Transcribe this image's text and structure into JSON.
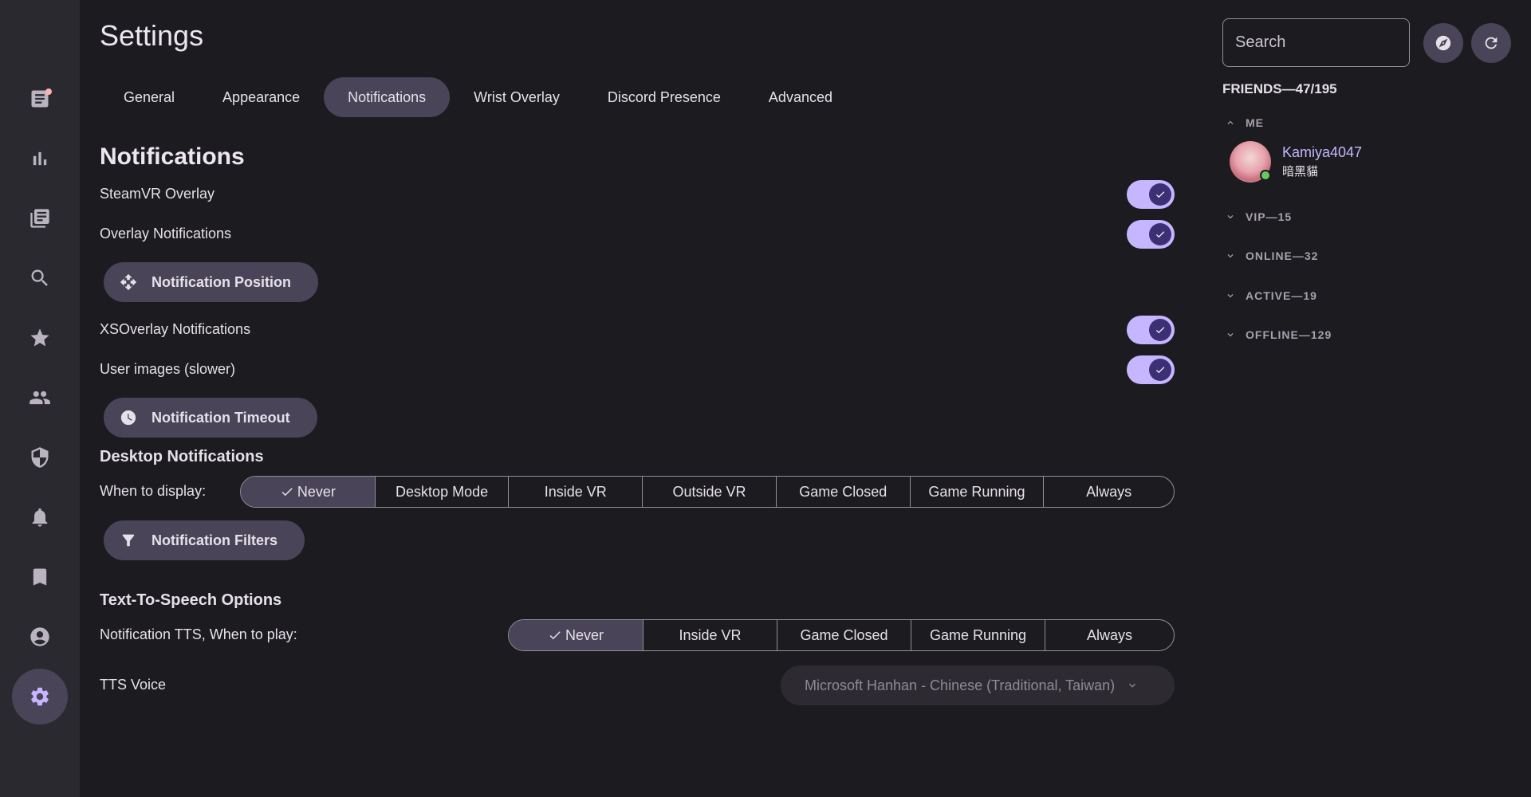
{
  "page": {
    "title": "Settings"
  },
  "tabs": [
    {
      "label": "General"
    },
    {
      "label": "Appearance"
    },
    {
      "label": "Notifications"
    },
    {
      "label": "Wrist Overlay"
    },
    {
      "label": "Discord Presence"
    },
    {
      "label": "Advanced"
    }
  ],
  "active_tab": "Notifications",
  "notifications": {
    "section_title": "Notifications",
    "steamvr_overlay": {
      "label": "SteamVR Overlay",
      "enabled": true
    },
    "overlay_notifications": {
      "label": "Overlay Notifications",
      "enabled": true
    },
    "notification_position_button": "Notification Position",
    "xsoverlay_notifications": {
      "label": "XSOverlay Notifications",
      "enabled": true
    },
    "user_images": {
      "label": "User images (slower)",
      "enabled": true
    },
    "notification_timeout_button": "Notification Timeout"
  },
  "desktop": {
    "title": "Desktop Notifications",
    "when_label": "When to display:",
    "options": [
      "Never",
      "Desktop Mode",
      "Inside VR",
      "Outside VR",
      "Game Closed",
      "Game Running",
      "Always"
    ],
    "selected": "Never",
    "filters_button": "Notification Filters"
  },
  "tts": {
    "title": "Text-To-Speech Options",
    "when_label": "Notification TTS, When to play:",
    "options": [
      "Never",
      "Inside VR",
      "Game Closed",
      "Game Running",
      "Always"
    ],
    "selected": "Never",
    "voice_label": "TTS Voice",
    "voice_value": "Microsoft Hanhan - Chinese (Traditional, Taiwan)"
  },
  "nav": {
    "items": [
      {
        "icon": "feed-icon",
        "has_badge": true
      },
      {
        "icon": "chart-icon"
      },
      {
        "icon": "game-log-icon"
      },
      {
        "icon": "search-icon"
      },
      {
        "icon": "star-icon"
      },
      {
        "icon": "people-icon"
      },
      {
        "icon": "shield-icon"
      },
      {
        "icon": "bell-icon"
      },
      {
        "icon": "bookmark-icon"
      },
      {
        "icon": "account-icon"
      },
      {
        "icon": "settings-icon",
        "active": true
      }
    ]
  },
  "sidebar": {
    "search_placeholder": "Search",
    "friends_header": "FRIENDS—47/195",
    "groups": {
      "me": "ME",
      "vip": "VIP—15",
      "online": "ONLINE—32",
      "active": "ACTIVE—19",
      "offline": "OFFLINE—129"
    },
    "me_friend": {
      "name": "Kamiya4047",
      "status": "暗黑貓",
      "online": true
    }
  },
  "colors": {
    "background": "#1c1b20",
    "rail": "#2b2930",
    "accent": "#c6b6ff",
    "tonal": "#4a4458",
    "online": "#66c95d"
  }
}
